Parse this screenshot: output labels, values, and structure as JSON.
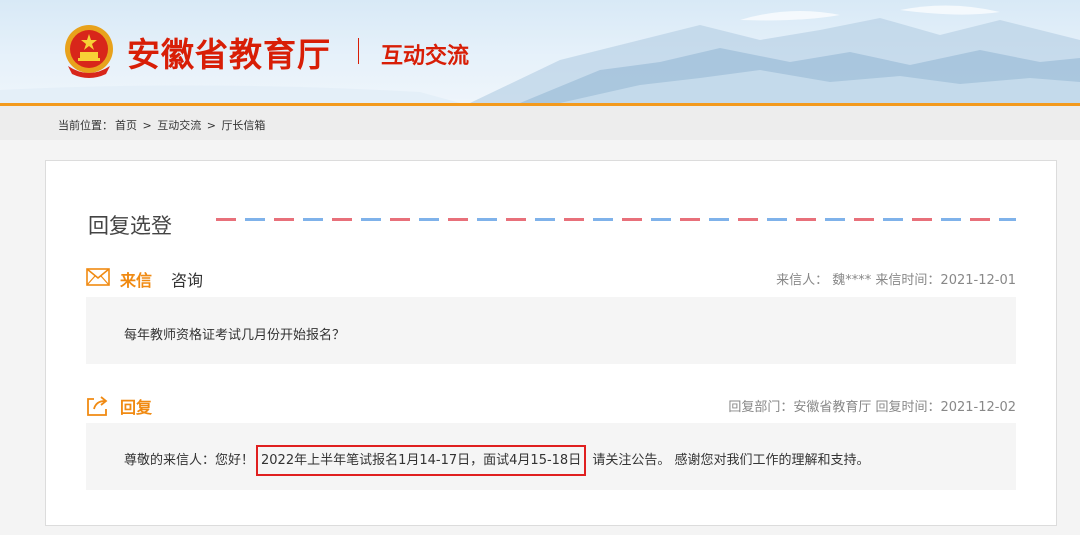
{
  "header": {
    "site_title": "安徽省教育厅",
    "section": "互动交流",
    "brand_color": "#d81e06",
    "accent_color": "#f39a1d",
    "emblem_icon": "national-emblem-icon"
  },
  "breadcrumb": {
    "prefix": "当前位置：",
    "items": [
      "首页",
      ">",
      "互动交流",
      ">",
      "厅长信箱"
    ]
  },
  "panel": {
    "title": "回复选登",
    "letter": {
      "label": "来信",
      "subject": "咨询",
      "meta": "来信人：  魏****  来信时间：2021-12-01",
      "content": "每年教师资格证考试几月份开始报名？",
      "icon": "envelope-icon"
    },
    "reply": {
      "label": "回复",
      "meta": "回复部门：安徽省教育厅  回复时间：2021-12-02",
      "content_before": "尊敬的来信人：您好！",
      "content_highlight": "2022年上半年笔试报名1月14-17日，面试4月15-18日",
      "content_after": "请关注公告。 感谢您对我们工作的理解和支持。",
      "icon": "share-reply-icon",
      "highlight_color": "#e02020"
    },
    "dash_colors": [
      "#e8707a",
      "#7fb2ea"
    ]
  }
}
